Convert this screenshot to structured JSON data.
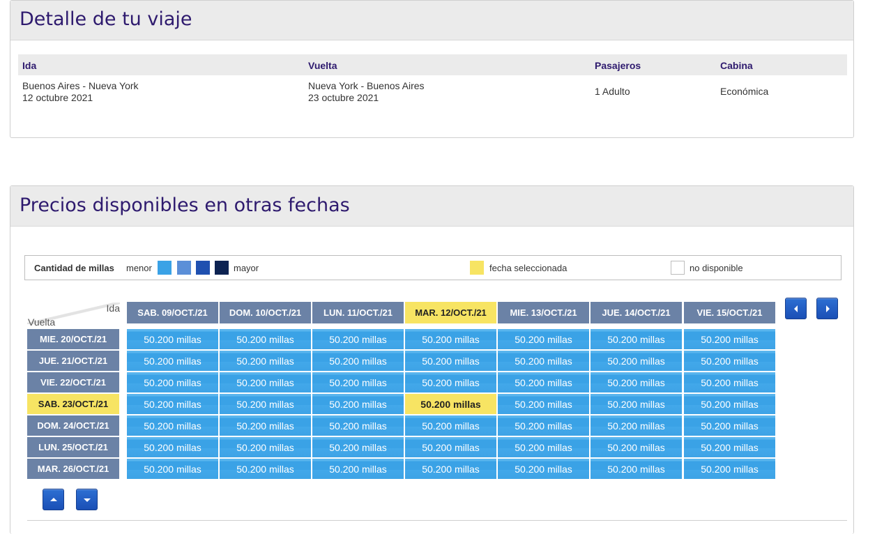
{
  "trip": {
    "title": "Detalle de tu viaje",
    "headers": {
      "ida": "Ida",
      "vuelta": "Vuelta",
      "pasajeros": "Pasajeros",
      "cabina": "Cabina"
    },
    "ida_route": "Buenos Aires - Nueva York",
    "ida_date": "12 octubre 2021",
    "vuelta_route": "Nueva York - Buenos Aires",
    "vuelta_date": "23 octubre 2021",
    "pasajeros": "1 Adulto",
    "cabina": "Económica"
  },
  "prices": {
    "title": "Precios disponibles en otras fechas",
    "legend": {
      "label": "Cantidad de millas",
      "menor": "menor",
      "mayor": "mayor",
      "scale_colors": [
        "#3aa2e6",
        "#5b8fd8",
        "#1f50b0",
        "#0d2352"
      ],
      "selected_label": "fecha seleccionada",
      "selected_color": "#f7e463",
      "unavailable_label": "no disponible"
    },
    "corner": {
      "ida": "Ida",
      "vuelta": "Vuelta"
    },
    "columns": [
      "SAB. 09/OCT./21",
      "DOM. 10/OCT./21",
      "LUN. 11/OCT./21",
      "MAR. 12/OCT./21",
      "MIE. 13/OCT./21",
      "JUE. 14/OCT./21",
      "VIE. 15/OCT./21"
    ],
    "rows": [
      "MIE. 20/OCT./21",
      "JUE. 21/OCT./21",
      "VIE. 22/OCT./21",
      "SAB. 23/OCT./21",
      "DOM. 24/OCT./21",
      "LUN. 25/OCT./21",
      "MAR. 26/OCT./21"
    ],
    "price_label": "50.200 millas",
    "selected_column": 3,
    "selected_row": 3,
    "nav_icons": {
      "prev": "caret-left-icon",
      "next": "caret-right-icon",
      "up": "caret-up-icon",
      "down": "caret-down-icon"
    }
  }
}
